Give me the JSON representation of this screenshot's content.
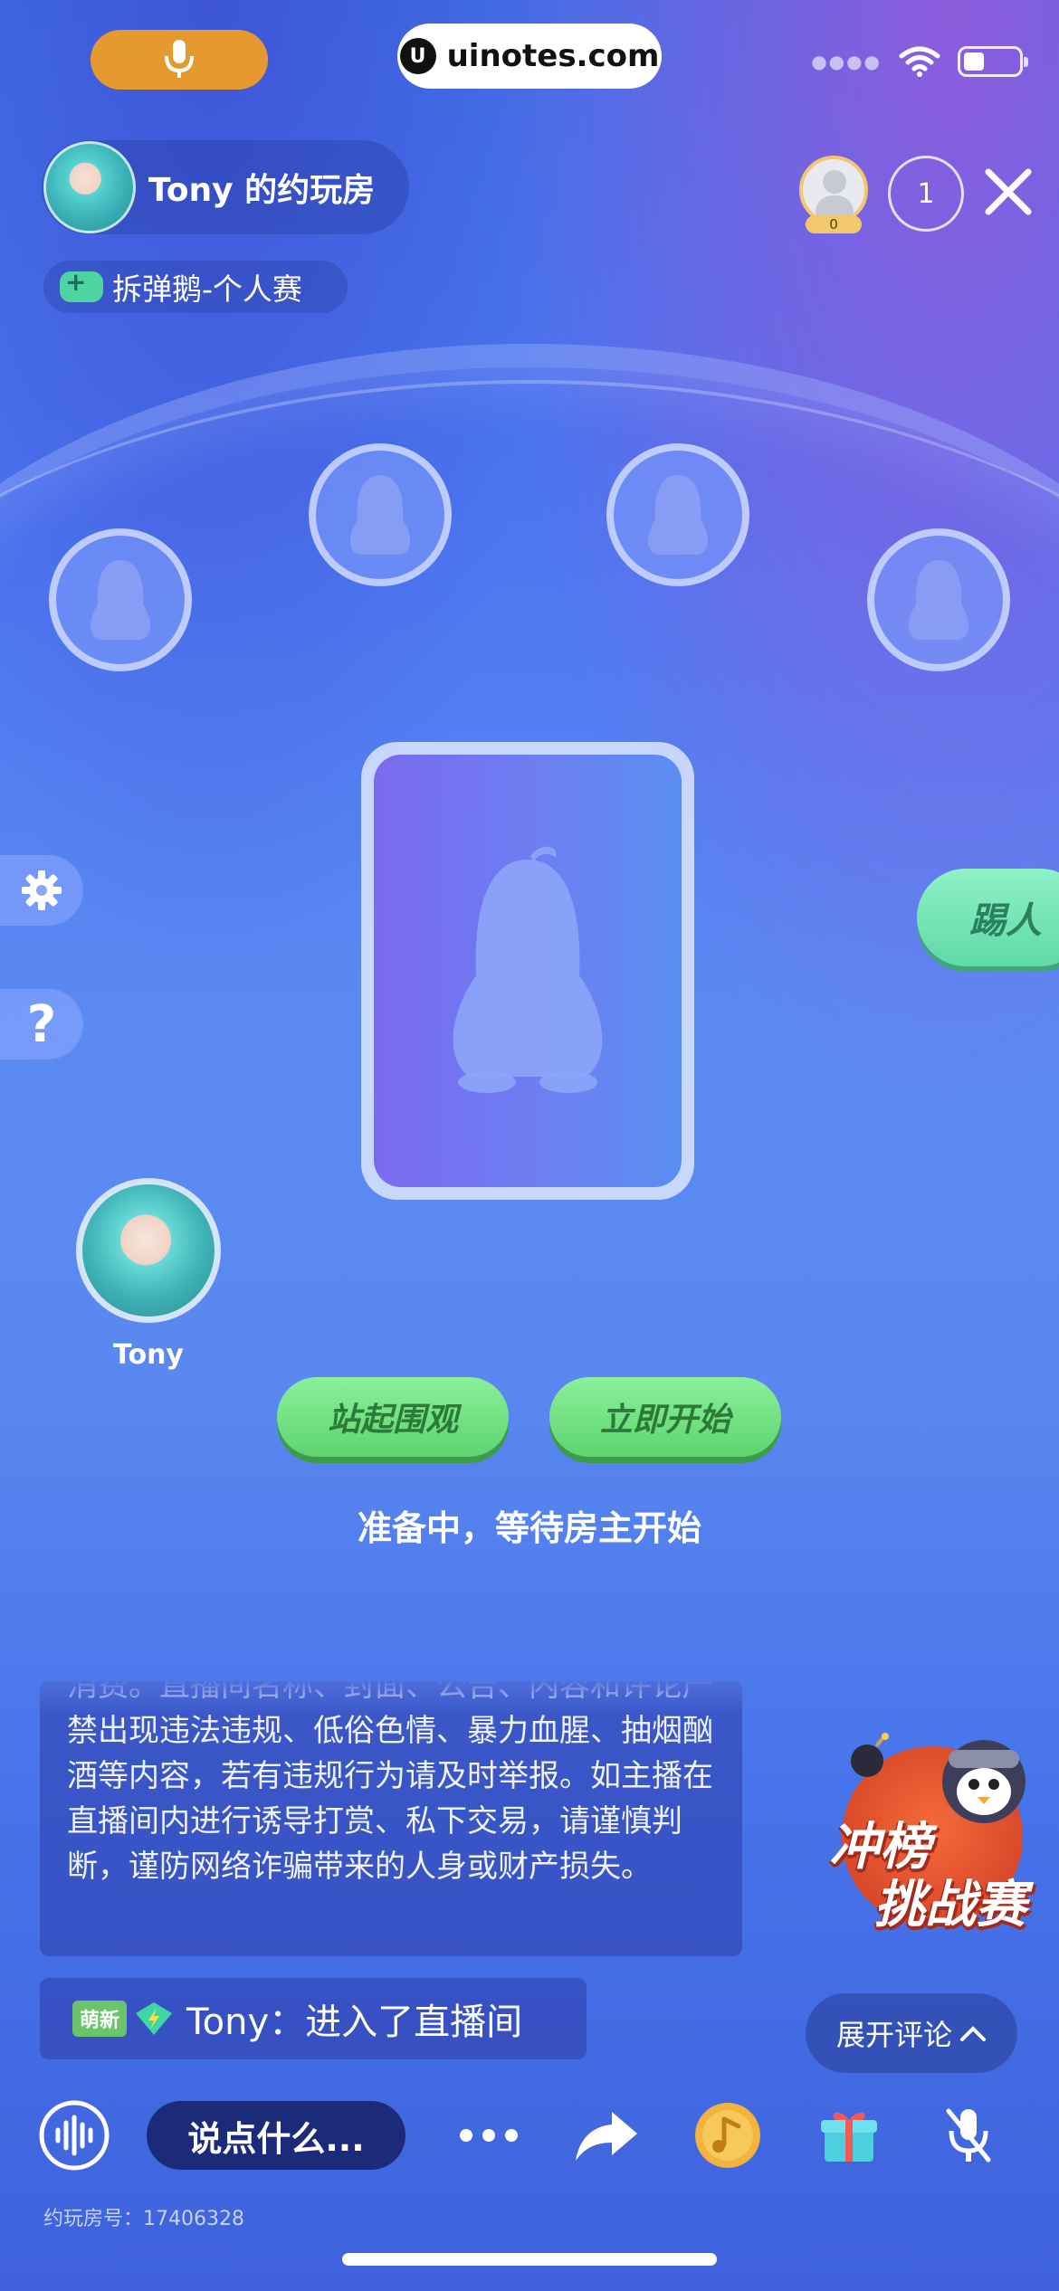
{
  "status_bar": {
    "url": "uinotes.com",
    "url_logo": "U"
  },
  "room": {
    "title": "Tony 的约玩房",
    "game_tag": "拆弹鹅-个人赛",
    "viewer_count_badge": "0",
    "online_count": "1",
    "room_number": "约玩房号：17406328"
  },
  "side": {
    "kick_label": "踢人"
  },
  "player": {
    "name": "Tony"
  },
  "actions": {
    "stand_watch": "站起围观",
    "start_now": "立即开始",
    "status_text": "准备中，等待房主开始"
  },
  "notice": {
    "text": "消费。直播间名称、封面、公告、内容和评论严禁出现违法违规、低俗色情、暴力血腥、抽烟酗酒等内容，若有违规行为请及时举报。如主播在直播间内进行诱导打赏、私下交易，请谨慎判断，谨防网络诈骗带来的人身或财产损失。"
  },
  "chat": {
    "badge": "萌新",
    "message": "Tony：进入了直播间"
  },
  "promo": {
    "line1": "冲榜",
    "line2": "挑战赛"
  },
  "comments": {
    "expand_label": "展开评论"
  },
  "input": {
    "placeholder": "说点什么..."
  },
  "colors": {
    "mic_pill": "#e6992e",
    "green_button": "#5fd46f",
    "kick_button": "#5fd9a5"
  }
}
